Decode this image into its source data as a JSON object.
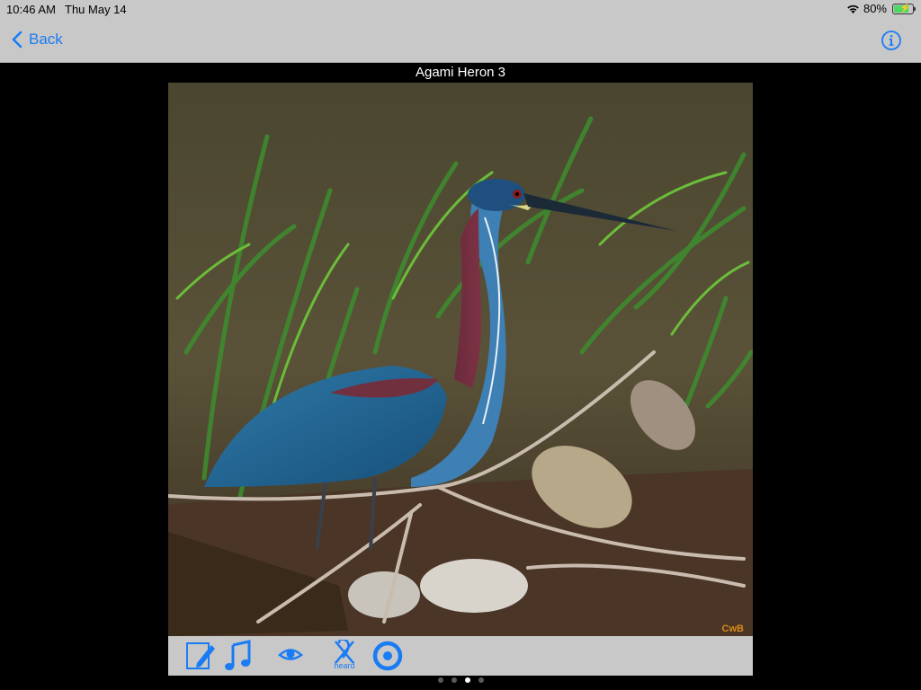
{
  "status_bar": {
    "time": "10:46 AM",
    "date": "Thu May 14",
    "battery": "80%",
    "battery_level": 0.8
  },
  "nav": {
    "back_label": "Back"
  },
  "image": {
    "title": "Agami Heron 3",
    "watermark": "CwB"
  },
  "toolbar": {
    "tools": [
      {
        "name": "edit-note-icon"
      },
      {
        "name": "music-note-icon"
      },
      {
        "name": "eye-icon"
      },
      {
        "name": "not-heard-icon",
        "label": "heard"
      },
      {
        "name": "target-icon"
      }
    ]
  },
  "pagination": {
    "count": 4,
    "current": 3
  },
  "colors": {
    "accent": "#1a7cf5",
    "bar_background": "#c8c8c8"
  }
}
